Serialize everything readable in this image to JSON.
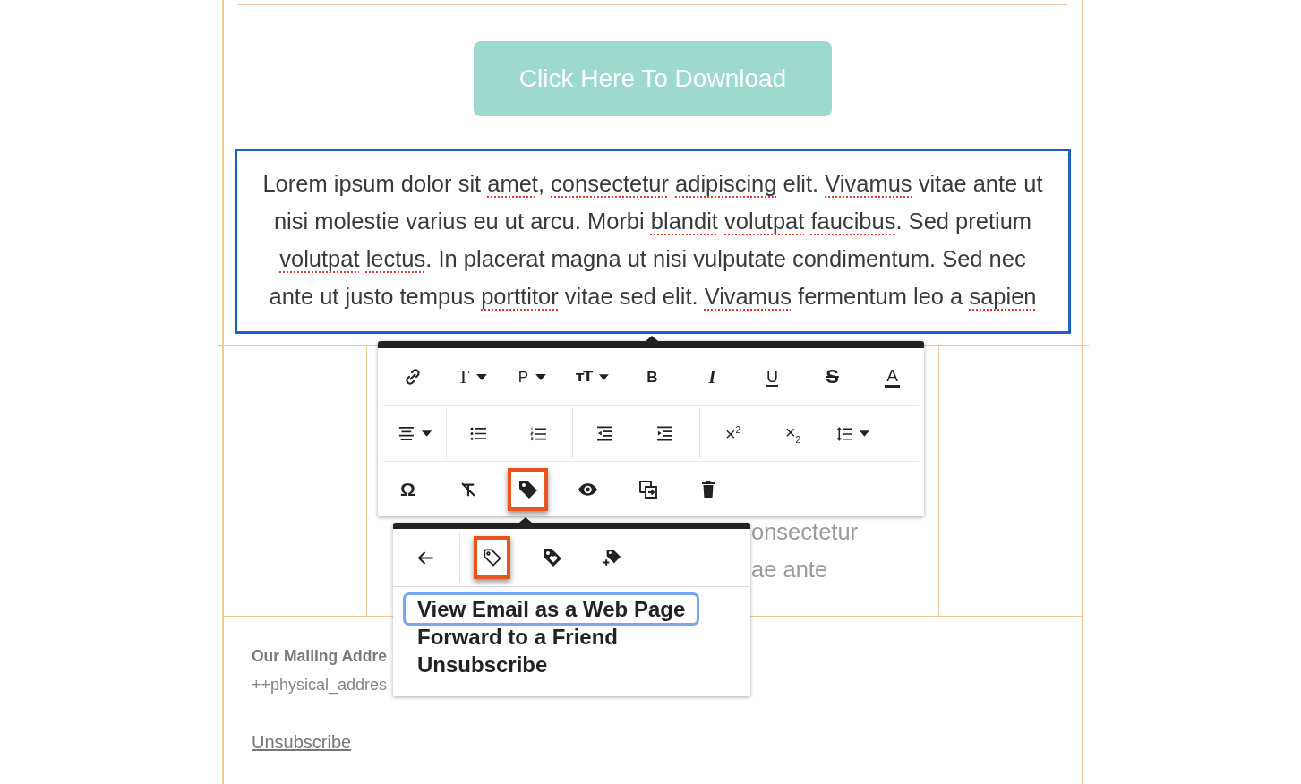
{
  "download_button": {
    "label": "Click Here To Download"
  },
  "text_block": {
    "selected": true,
    "segments": [
      {
        "text": "Lorem ipsum dolor sit ",
        "misspelled": false
      },
      {
        "text": "amet",
        "misspelled": true
      },
      {
        "text": ", ",
        "misspelled": false
      },
      {
        "text": "consectetur ",
        "misspelled": true
      },
      {
        "text": "adipiscing",
        "misspelled": true
      },
      {
        "text": " elit. ",
        "misspelled": false
      },
      {
        "text": "Vivamus",
        "misspelled": true
      },
      {
        "text": " vitae ante ut nisi molestie varius eu ut arcu. Morbi ",
        "misspelled": false
      },
      {
        "text": "blandit ",
        "misspelled": true
      },
      {
        "text": "volutpat ",
        "misspelled": true
      },
      {
        "text": "faucibus",
        "misspelled": true
      },
      {
        "text": ". Sed pretium ",
        "misspelled": false
      },
      {
        "text": "volutpat ",
        "misspelled": true
      },
      {
        "text": "lectus",
        "misspelled": true
      },
      {
        "text": ". In placerat magna ut nisi vulputate condimentum. Sed nec ante ut justo tempus ",
        "misspelled": false
      },
      {
        "text": "porttitor",
        "misspelled": true
      },
      {
        "text": " vitae sed elit. ",
        "misspelled": false
      },
      {
        "text": "Vivamus",
        "misspelled": true
      },
      {
        "text": " fermentum leo a ",
        "misspelled": false
      },
      {
        "text": "sapien",
        "misspelled": true
      }
    ]
  },
  "format_toolbar": {
    "rows": [
      {
        "groups": [
          {
            "tools": [
              {
                "kind": "link",
                "dropdown": false,
                "highlighted": false
              },
              {
                "kind": "heading",
                "label": "T",
                "dropdown": true,
                "highlighted": false
              },
              {
                "kind": "paragraph",
                "label": "P",
                "dropdown": true,
                "highlighted": false
              },
              {
                "kind": "font-size",
                "label": "ᴛT",
                "dropdown": true,
                "highlighted": false
              },
              {
                "kind": "bold",
                "label": "B",
                "dropdown": false,
                "highlighted": false
              },
              {
                "kind": "italic",
                "label": "I",
                "dropdown": false,
                "highlighted": false
              },
              {
                "kind": "underline",
                "label": "U",
                "dropdown": false,
                "highlighted": false
              },
              {
                "kind": "strikethrough",
                "label": "S",
                "dropdown": false,
                "highlighted": false
              },
              {
                "kind": "font-color",
                "label": "A",
                "dropdown": false,
                "highlighted": false
              }
            ]
          }
        ]
      },
      {
        "groups": [
          {
            "tools": [
              {
                "kind": "align",
                "dropdown": true,
                "highlighted": false
              }
            ]
          },
          {
            "tools": [
              {
                "kind": "bullet-list",
                "dropdown": false,
                "highlighted": false
              },
              {
                "kind": "numbered-list",
                "dropdown": false,
                "highlighted": false
              }
            ]
          },
          {
            "tools": [
              {
                "kind": "outdent",
                "dropdown": false,
                "highlighted": false
              },
              {
                "kind": "indent",
                "dropdown": false,
                "highlighted": false
              }
            ]
          },
          {
            "tools": [
              {
                "kind": "superscript",
                "label": "×$^{2}$",
                "dropdown": false,
                "highlighted": false
              },
              {
                "kind": "subscript",
                "label": "×$_{2}$",
                "dropdown": false,
                "highlighted": false
              },
              {
                "kind": "line-height",
                "dropdown": true,
                "highlighted": false
              }
            ]
          }
        ]
      },
      {
        "groups": [
          {
            "tools": [
              {
                "kind": "special-character",
                "label": "Ω",
                "dropdown": false,
                "highlighted": false
              },
              {
                "kind": "clear-format",
                "dropdown": false,
                "highlighted": false
              },
              {
                "kind": "merge-tag",
                "dropdown": false,
                "highlighted": true
              },
              {
                "kind": "preview",
                "dropdown": false,
                "highlighted": false
              },
              {
                "kind": "duplicate",
                "dropdown": false,
                "highlighted": false
              },
              {
                "kind": "delete",
                "dropdown": false,
                "highlighted": false
              }
            ]
          }
        ]
      }
    ]
  },
  "hidden_paragraph": {
    "fragments": [
      "onsectetur",
      "ae ante"
    ]
  },
  "merge_tag_menu": {
    "tools": [
      {
        "kind": "back",
        "highlighted": false
      },
      {
        "kind": "tag",
        "highlighted": true
      },
      {
        "kind": "tag-heart",
        "highlighted": false
      },
      {
        "kind": "tag-plus",
        "highlighted": false
      }
    ],
    "items": [
      {
        "label": "View Email as a Web Page",
        "selected": true
      },
      {
        "label": "Forward to a Friend",
        "selected": false
      },
      {
        "label": "Unsubscribe",
        "selected": false
      }
    ]
  },
  "footer": {
    "heading": "Our Mailing Addre",
    "address": "++physical_addres",
    "unsubscribe": "Unsubscribe"
  }
}
